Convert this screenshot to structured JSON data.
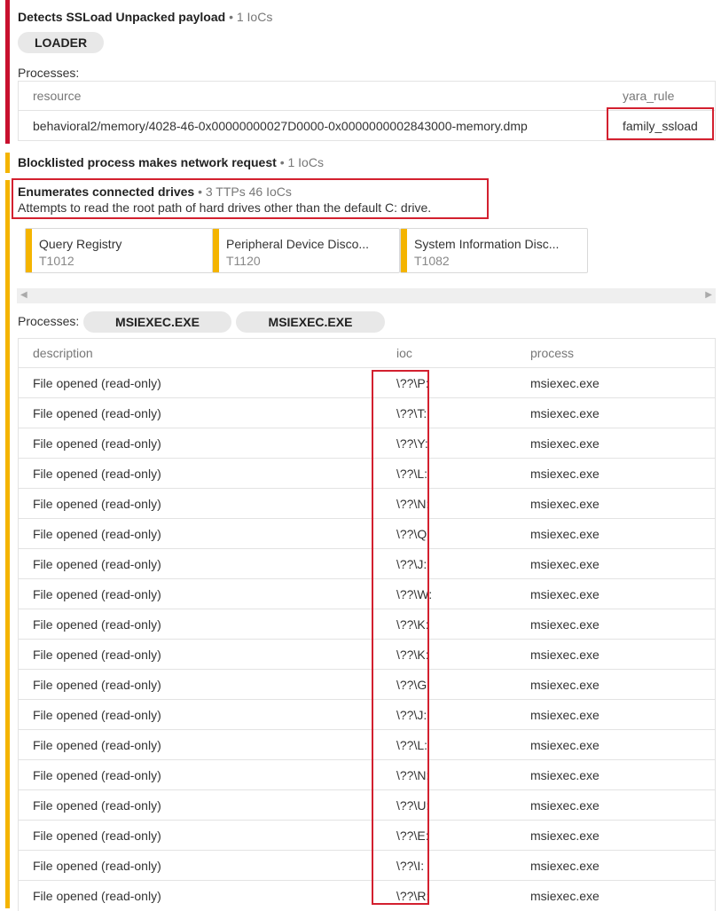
{
  "signature1": {
    "title": "Detects SSLoad Unpacked payload",
    "meta": "• 1 IoCs",
    "tag": "LOADER",
    "processes_label": "Processes:",
    "columns": [
      "resource",
      "yara_rule"
    ],
    "rows": [
      [
        "behavioral2/memory/4028-46-0x00000000027D0000-0x0000000002843000-memory.dmp",
        "family_ssload"
      ]
    ]
  },
  "signature2": {
    "title": "Blocklisted process makes network request",
    "meta": "• 1 IoCs"
  },
  "signature3": {
    "title": "Enumerates connected drives",
    "meta": "• 3 TTPs 46 IoCs",
    "description": "Attempts to read the root path of hard drives other than the default C: drive.",
    "ttps": [
      {
        "name": "Query Registry",
        "code": "T1012"
      },
      {
        "name": "Peripheral Device Disco...",
        "code": "T1120"
      },
      {
        "name": "System Information Disc...",
        "code": "T1082"
      }
    ],
    "scroll_left": "◀",
    "scroll_right": "▶",
    "processes_label": "Processes:",
    "process_tabs": [
      "MSIEXEC.EXE",
      "MSIEXEC.EXE"
    ],
    "columns": [
      "description",
      "ioc",
      "process"
    ],
    "rows": [
      [
        "File opened (read-only)",
        "\\??\\P:",
        "msiexec.exe"
      ],
      [
        "File opened (read-only)",
        "\\??\\T:",
        "msiexec.exe"
      ],
      [
        "File opened (read-only)",
        "\\??\\Y:",
        "msiexec.exe"
      ],
      [
        "File opened (read-only)",
        "\\??\\L:",
        "msiexec.exe"
      ],
      [
        "File opened (read-only)",
        "\\??\\N:",
        "msiexec.exe"
      ],
      [
        "File opened (read-only)",
        "\\??\\Q:",
        "msiexec.exe"
      ],
      [
        "File opened (read-only)",
        "\\??\\J:",
        "msiexec.exe"
      ],
      [
        "File opened (read-only)",
        "\\??\\W:",
        "msiexec.exe"
      ],
      [
        "File opened (read-only)",
        "\\??\\K:",
        "msiexec.exe"
      ],
      [
        "File opened (read-only)",
        "\\??\\K:",
        "msiexec.exe"
      ],
      [
        "File opened (read-only)",
        "\\??\\G:",
        "msiexec.exe"
      ],
      [
        "File opened (read-only)",
        "\\??\\J:",
        "msiexec.exe"
      ],
      [
        "File opened (read-only)",
        "\\??\\L:",
        "msiexec.exe"
      ],
      [
        "File opened (read-only)",
        "\\??\\N:",
        "msiexec.exe"
      ],
      [
        "File opened (read-only)",
        "\\??\\U:",
        "msiexec.exe"
      ],
      [
        "File opened (read-only)",
        "\\??\\E:",
        "msiexec.exe"
      ],
      [
        "File opened (read-only)",
        "\\??\\I:",
        "msiexec.exe"
      ],
      [
        "File opened (read-only)",
        "\\??\\R:",
        "msiexec.exe"
      ]
    ]
  },
  "colors": {
    "critical": "#c8102e",
    "warning": "#f4b400",
    "highlight_box": "#d3202f"
  }
}
